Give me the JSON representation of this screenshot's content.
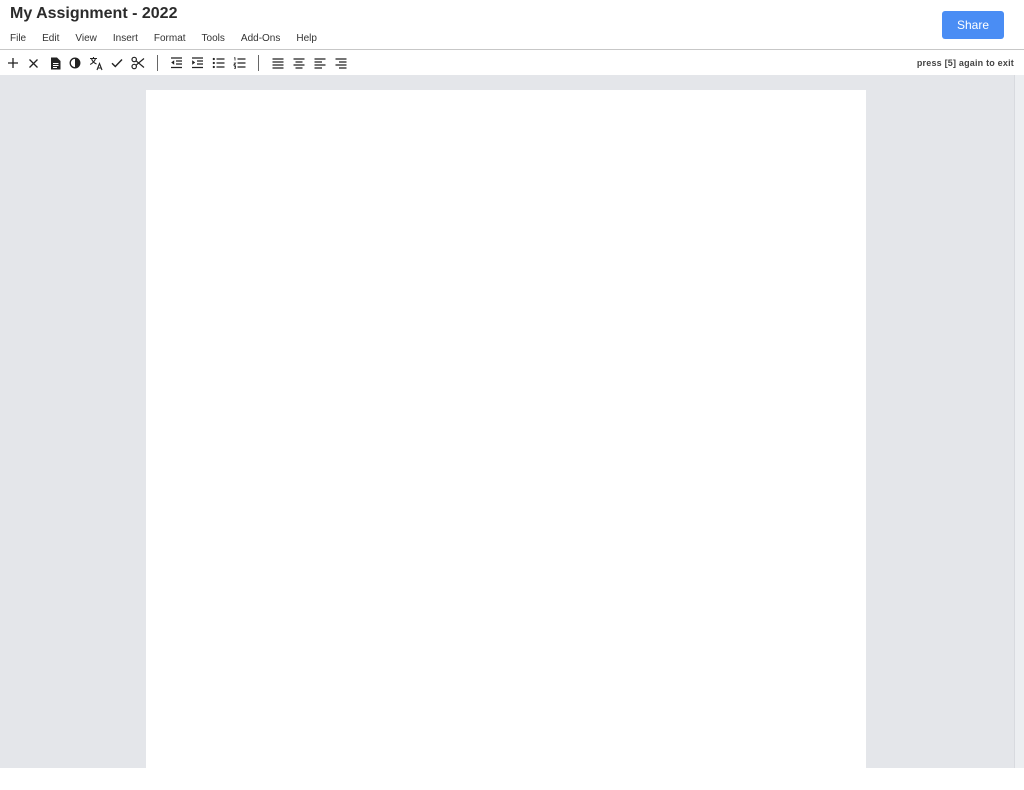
{
  "document": {
    "title": "My Assignment - 2022"
  },
  "menu": {
    "items": [
      "File",
      "Edit",
      "View",
      "Insert",
      "Format",
      "Tools",
      "Add-Ons",
      "Help"
    ]
  },
  "share": {
    "label": "Share"
  },
  "toolbar": {
    "exit_hint": "press [5] again to exit",
    "icons": [
      "add-icon",
      "close-icon",
      "document-icon",
      "contrast-icon",
      "translate-icon",
      "check-icon",
      "scissors-icon",
      "indent-decrease-icon",
      "indent-increase-icon",
      "bulleted-list-icon",
      "numbered-list-icon",
      "align-justify-icon",
      "align-center-icon",
      "align-left-icon",
      "align-right-icon"
    ]
  },
  "colors": {
    "share_button": "#4a8df4",
    "canvas_background": "#e4e6ea",
    "page_background": "#ffffff"
  }
}
